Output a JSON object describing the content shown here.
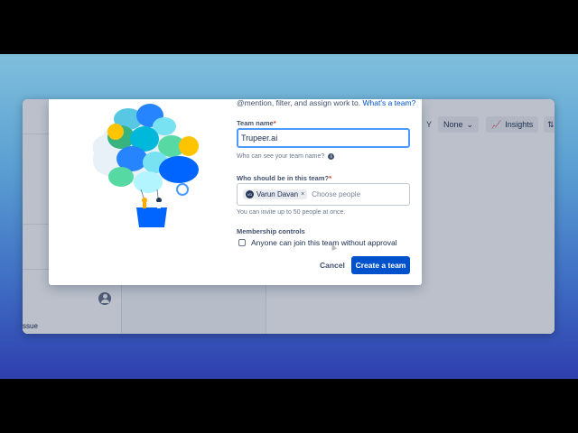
{
  "intro": {
    "text": "@mention, filter, and assign work to.",
    "link": "What's a team?"
  },
  "team_name": {
    "label": "Team name",
    "required": "*",
    "value": "Trupeer.ai",
    "helper": "Who can see your team name?",
    "info_icon": "info-icon"
  },
  "members": {
    "label": "Who should be in this team?",
    "required": "*",
    "chip": {
      "initials": "VD",
      "name": "Varun Davan",
      "remove": "×"
    },
    "placeholder": "Choose people",
    "helper": "You can invite up to 50 people at once."
  },
  "membership": {
    "label": "Membership controls",
    "option": "Anyone can join this team without approval",
    "checked": false
  },
  "actions": {
    "cancel": "Cancel",
    "create": "Create a team"
  },
  "background_app": {
    "group_by_suffix": "Y",
    "group_by": "None",
    "insights": "Insights",
    "issue_label": "ssue"
  },
  "colors": {
    "primary": "#0052cc",
    "focus": "#4c9aff",
    "required": "#de350b"
  }
}
